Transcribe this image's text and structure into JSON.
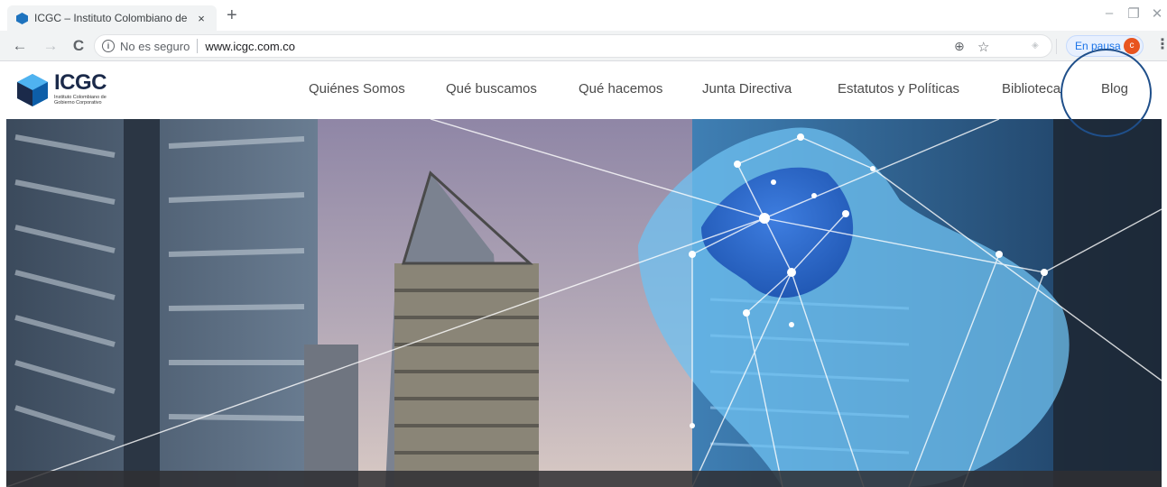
{
  "browser": {
    "tab": {
      "title": "ICGC – Instituto Colombiano de G",
      "close_label": "×",
      "favicon": "icgc-favicon-icon"
    },
    "new_tab_label": "+",
    "window_controls": {
      "minimize": "–",
      "restore": "❐",
      "close": "✕"
    },
    "nav": {
      "back": "←",
      "forward": "→",
      "reload": "C"
    },
    "omnibox": {
      "info_icon": "i",
      "security_text": "No es seguro",
      "url": "www.icgc.com.co",
      "zoom_icon": "⊕",
      "star_icon": "☆"
    },
    "profile": {
      "status_text": "En pausa",
      "avatar_letter": "c"
    },
    "menu_icon": "⋮"
  },
  "site": {
    "logo": {
      "text": "ICGC",
      "subtitle": "Instituto Colombiano de Gobierno Corporativo"
    },
    "nav": [
      {
        "label": "Quiénes Somos"
      },
      {
        "label": "Qué buscamos"
      },
      {
        "label": "Qué hacemos"
      },
      {
        "label": "Junta Directiva"
      },
      {
        "label": "Estatutos y Políticas"
      },
      {
        "label": "Biblioteca"
      },
      {
        "label": "Blog"
      }
    ],
    "highlight": "Blog"
  },
  "colors": {
    "brand_navy": "#1b2a4a",
    "brand_blue": "#1e88d6",
    "highlight_circle": "#1f4f8a",
    "profile_avatar": "#e8541f"
  }
}
